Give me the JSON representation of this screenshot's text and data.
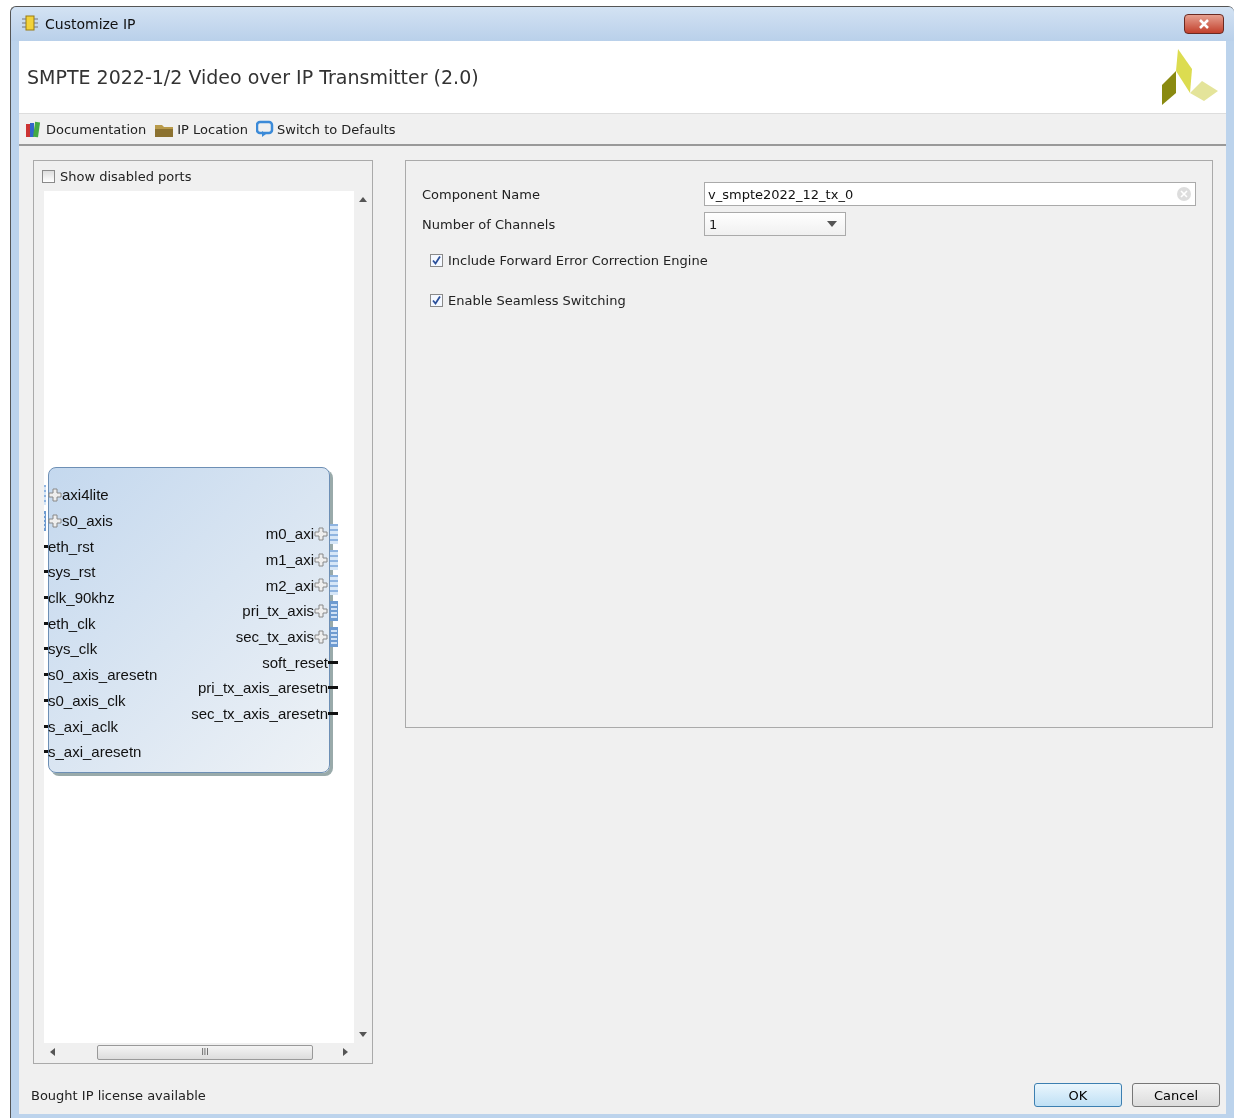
{
  "window": {
    "title": "Customize IP"
  },
  "header": {
    "title": "SMPTE 2022-1/2 Video over IP Transmitter (2.0)"
  },
  "toolbar": [
    {
      "kind": "docs",
      "label": "Documentation"
    },
    {
      "kind": "folder",
      "label": "IP Location"
    },
    {
      "kind": "reset",
      "label": "Switch to Defaults"
    }
  ],
  "symbol_panel": {
    "show_disabled_ports": {
      "label": "Show disabled ports",
      "checked": false
    },
    "left_ports": [
      {
        "name": "axi4lite",
        "kind": "aximm"
      },
      {
        "name": "s0_axis",
        "kind": "axis"
      },
      {
        "name": "eth_rst",
        "kind": "wire"
      },
      {
        "name": "sys_rst",
        "kind": "wire"
      },
      {
        "name": "clk_90khz",
        "kind": "wire"
      },
      {
        "name": "eth_clk",
        "kind": "wire"
      },
      {
        "name": "sys_clk",
        "kind": "wire"
      },
      {
        "name": "s0_axis_aresetn",
        "kind": "wire"
      },
      {
        "name": "s0_axis_clk",
        "kind": "wire"
      },
      {
        "name": "s_axi_aclk",
        "kind": "wire"
      },
      {
        "name": "s_axi_aresetn",
        "kind": "wire"
      }
    ],
    "right_ports": [
      {
        "name": "m0_axi",
        "kind": "aximm"
      },
      {
        "name": "m1_axi",
        "kind": "aximm"
      },
      {
        "name": "m2_axi",
        "kind": "aximm"
      },
      {
        "name": "pri_tx_axis",
        "kind": "axis"
      },
      {
        "name": "sec_tx_axis",
        "kind": "axis"
      },
      {
        "name": "soft_reset",
        "kind": "wire"
      },
      {
        "name": "pri_tx_axis_aresetn",
        "kind": "wire"
      },
      {
        "name": "sec_tx_axis_aresetn",
        "kind": "wire"
      }
    ],
    "scroll_thumb_glyph": "III"
  },
  "settings": {
    "component_name": {
      "label": "Component Name",
      "value": "v_smpte2022_12_tx_0"
    },
    "number_of_channels": {
      "label": "Number of Channels",
      "value": "1"
    },
    "checkboxes": [
      {
        "label": "Include Forward Error Correction Engine",
        "checked": true
      },
      {
        "label": "Enable Seamless Switching",
        "checked": true
      }
    ]
  },
  "status_bar": {
    "text": "Bought IP license available"
  },
  "buttons": [
    {
      "label": "OK",
      "default": true
    },
    {
      "label": "Cancel",
      "default": false
    }
  ]
}
